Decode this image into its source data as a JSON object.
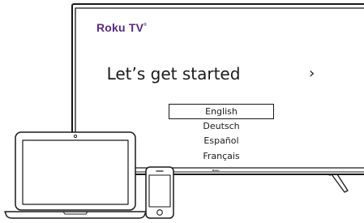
{
  "brand": {
    "name": "Roku TV",
    "mark": "®",
    "color": "#5b2a86"
  },
  "screen": {
    "headline": "Let’s get started",
    "next_icon": "›",
    "languages": [
      "English",
      "Deutsch",
      "Español",
      "Français"
    ],
    "selected_language": "English"
  },
  "tv_logo": "Roku"
}
